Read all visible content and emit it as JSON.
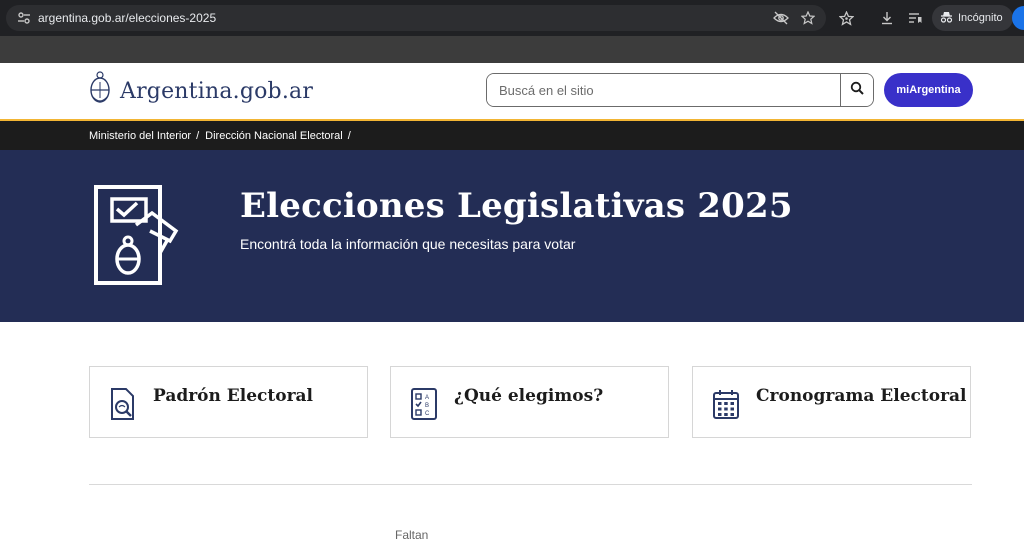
{
  "browser": {
    "url": "argentina.gob.ar/elecciones-2025",
    "incognito_label": "Incógnito",
    "icons": [
      "tune-icon",
      "eye-off-icon",
      "star-icon",
      "bookmark-star-icon",
      "download-icon",
      "reading-list-icon",
      "incognito-icon"
    ]
  },
  "header": {
    "logo_text": "Argentina.gob.ar",
    "search_placeholder": "Buscá en el sitio",
    "mi_argentina_label": "miArgentina"
  },
  "breadcrumb": [
    {
      "label": "Ministerio del Interior"
    },
    {
      "label": "Dirección Nacional Electoral"
    }
  ],
  "breadcrumb_separator": "/",
  "hero": {
    "title": "Elecciones Legislativas 2025",
    "subtitle": "Encontrá toda la información que necesitas para votar"
  },
  "cards": [
    {
      "label": "Padrón Electoral",
      "icon": "document-search-icon"
    },
    {
      "label": "¿Qué elegimos?",
      "icon": "checklist-icon"
    },
    {
      "label": "Cronograma Electoral",
      "icon": "calendar-icon"
    }
  ],
  "bottom_partial_text": "Faltan",
  "colors": {
    "hero_bg": "#232d55",
    "accent_button": "#3930c9",
    "gold_line": "#f2b534",
    "breadcrumb_bg": "#1c1c1c"
  }
}
